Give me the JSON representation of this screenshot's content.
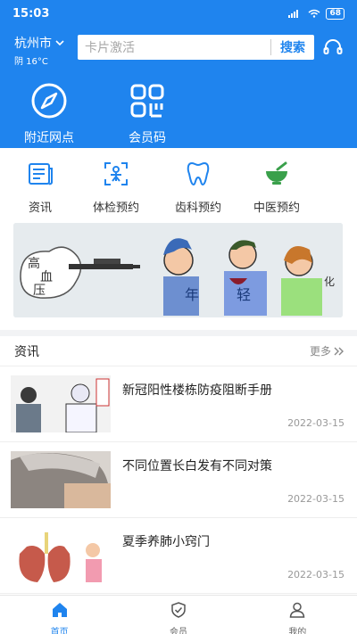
{
  "status_bar": {
    "time": "15:03",
    "battery": "68"
  },
  "location": {
    "city": "杭州市",
    "weather": "阴 16°C"
  },
  "search": {
    "placeholder": "卡片激活",
    "button": "搜索"
  },
  "quick_actions": [
    {
      "label": "附近网点",
      "icon": "compass-icon"
    },
    {
      "label": "会员码",
      "icon": "member-code-icon"
    }
  ],
  "services": [
    {
      "label": "资讯",
      "icon": "news-icon",
      "color": "#1f84ee"
    },
    {
      "label": "体检预约",
      "icon": "checkup-icon",
      "color": "#1f84ee"
    },
    {
      "label": "齿科预约",
      "icon": "tooth-icon",
      "color": "#1f84ee"
    },
    {
      "label": "中医预约",
      "icon": "herb-mortar-icon",
      "color": "#3aa04b"
    }
  ],
  "banner": {
    "words": [
      "高",
      "血",
      "压",
      "年",
      "轻",
      "化"
    ]
  },
  "news": {
    "title": "资讯",
    "more": "更多",
    "items": [
      {
        "title": "新冠阳性楼栋防疫阻断手册",
        "date": "2022-03-15"
      },
      {
        "title": "不同位置长白发有不同对策",
        "date": "2022-03-15"
      },
      {
        "title": "夏季养肺小窍门",
        "date": "2022-03-15"
      }
    ]
  },
  "tabs": [
    {
      "label": "首页",
      "icon": "home-icon",
      "active": true
    },
    {
      "label": "会员",
      "icon": "shield-check-icon",
      "active": false
    },
    {
      "label": "我的",
      "icon": "user-icon",
      "active": false
    }
  ],
  "colors": {
    "primary": "#1f84ee",
    "herb_green": "#3aa04b"
  }
}
